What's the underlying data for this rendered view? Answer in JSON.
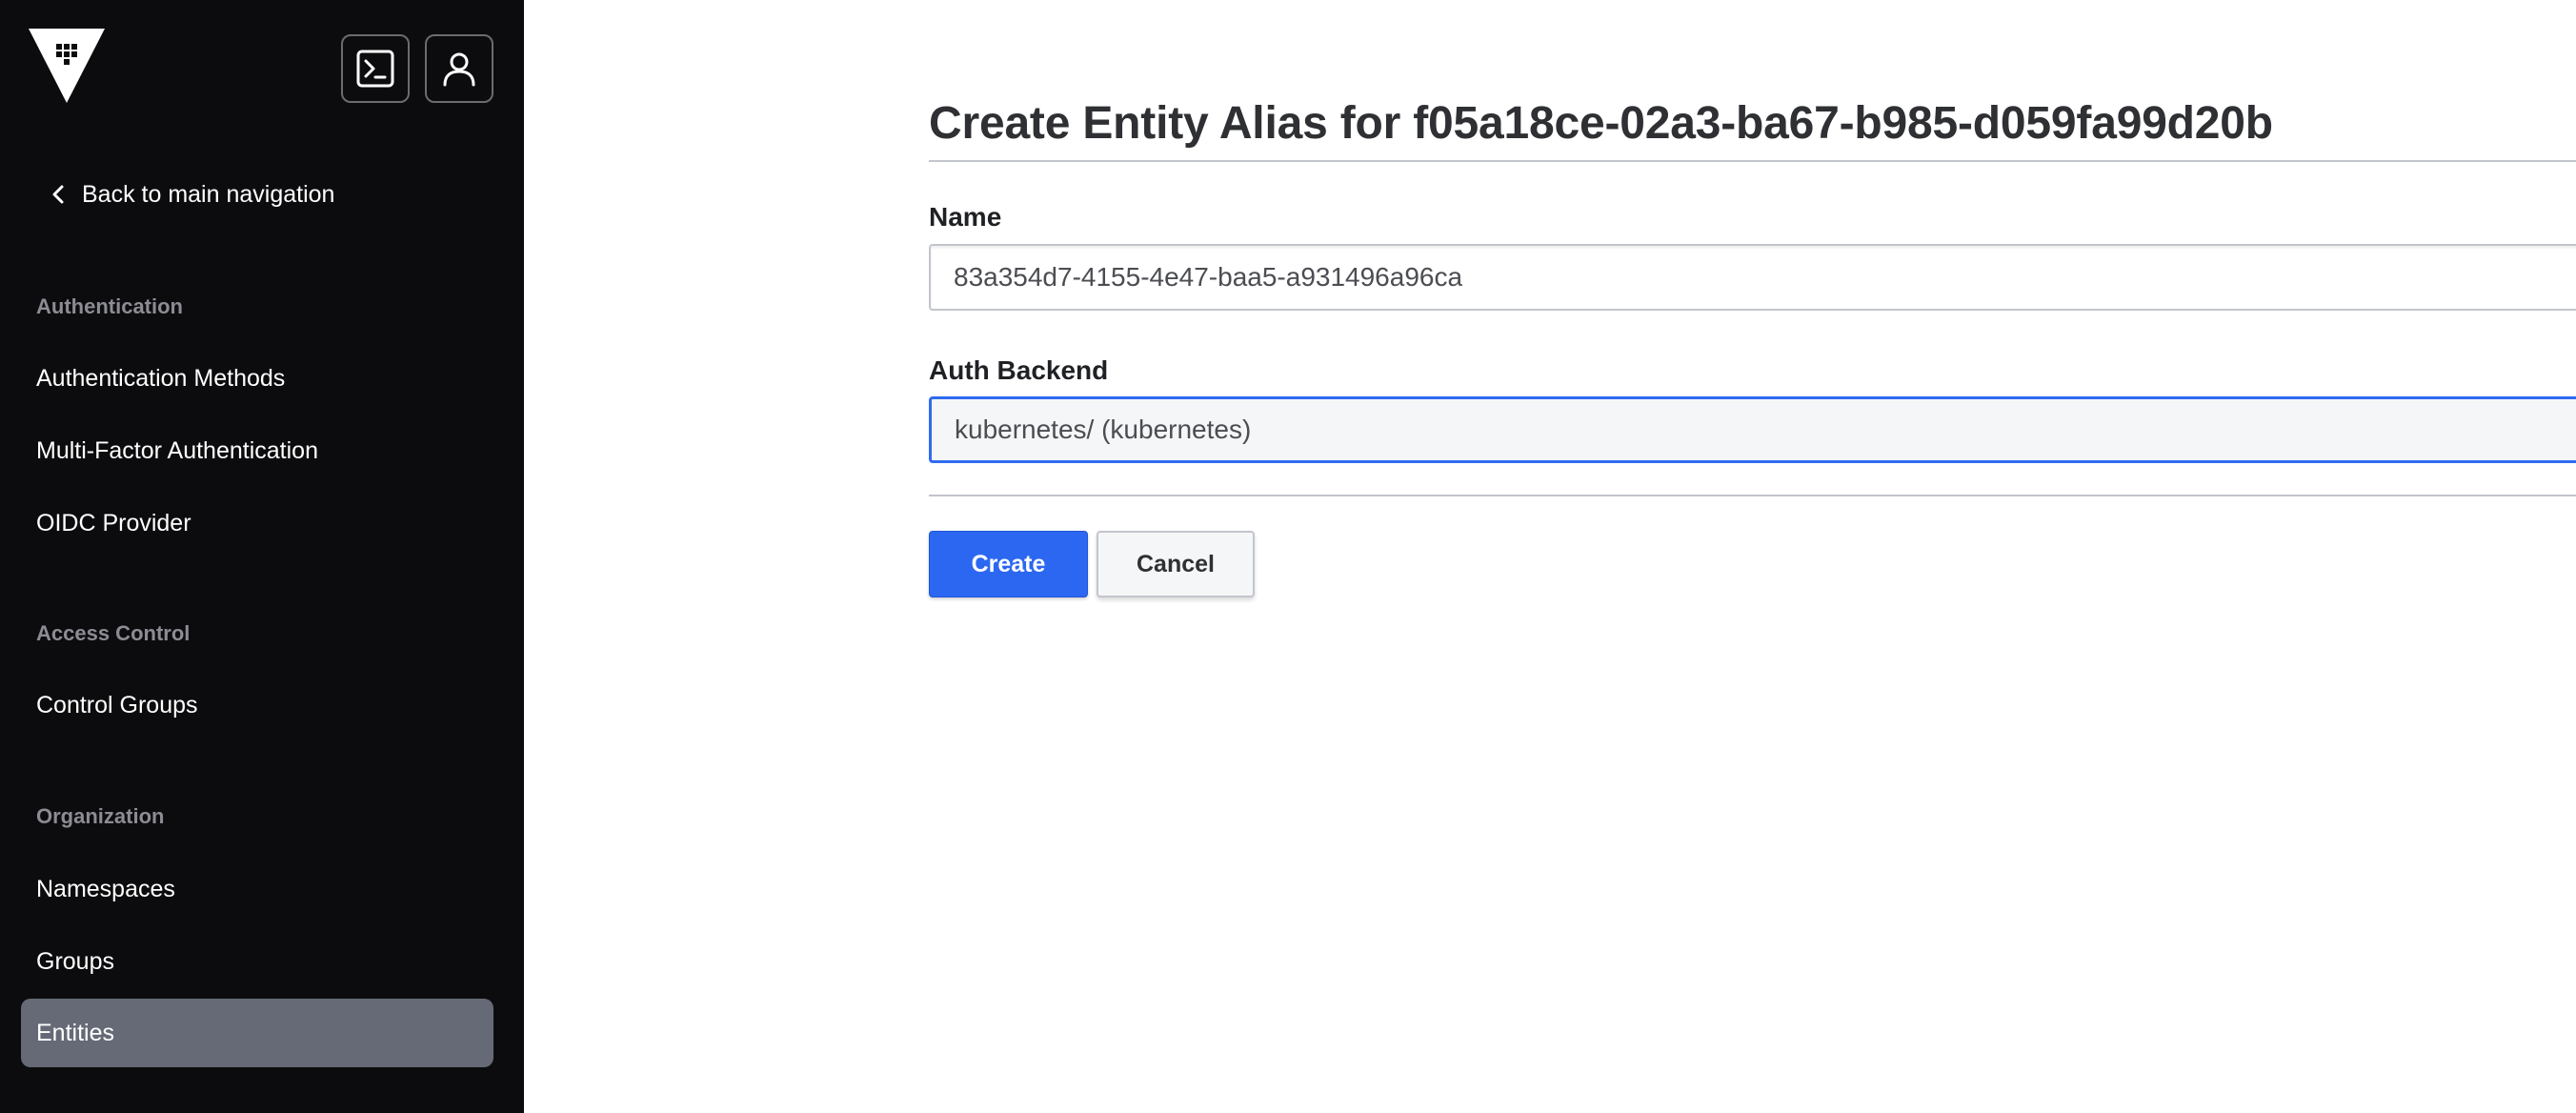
{
  "sidebar": {
    "back_label": "Back to main navigation",
    "sections": [
      {
        "title": "Authentication",
        "items": [
          "Authentication Methods",
          "Multi-Factor Authentication",
          "OIDC Provider"
        ]
      },
      {
        "title": "Access Control",
        "items": [
          "Control Groups"
        ]
      },
      {
        "title": "Organization",
        "items": [
          "Namespaces",
          "Groups",
          "Entities"
        ]
      }
    ],
    "active_item": "Entities",
    "icons": {
      "logo": "vault-logo-icon",
      "console": "console-icon",
      "user": "user-icon",
      "back": "chevron-left-icon"
    }
  },
  "main": {
    "title": "Create Entity Alias for f05a18ce-02a3-ba67-b985-d059fa99d20b",
    "name_field": {
      "label": "Name",
      "value": "83a354d7-4155-4e47-baa5-a931496a96ca"
    },
    "backend_field": {
      "label": "Auth Backend",
      "value": "kubernetes/ (kubernetes)"
    },
    "create_label": "Create",
    "cancel_label": "Cancel"
  },
  "colors": {
    "sidebar_bg": "#0c0c0e",
    "active_item_bg": "#656a76",
    "primary": "#2c67f2",
    "focus_border": "#2f6bf0",
    "text": "#2f3033"
  }
}
